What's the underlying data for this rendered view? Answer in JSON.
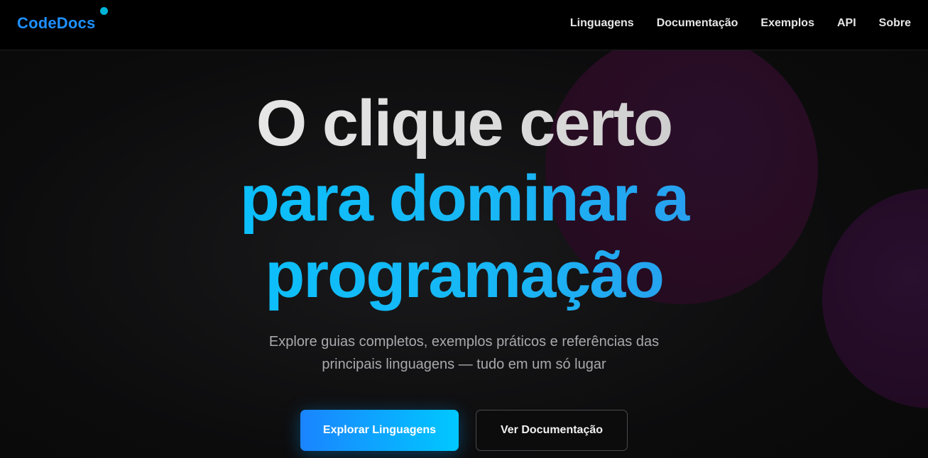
{
  "header": {
    "logo": "CodeDocs",
    "nav": [
      {
        "label": "Linguagens"
      },
      {
        "label": "Documentação"
      },
      {
        "label": "Exemplos"
      },
      {
        "label": "API"
      },
      {
        "label": "Sobre"
      }
    ]
  },
  "hero": {
    "title_line1": "O clique certo",
    "title_line2": "para dominar a",
    "title_line3": "programação",
    "subtitle": "Explore guias completos, exemplos práticos e referências das principais linguagens — tudo em um só lugar",
    "primary_button": "Explorar Linguagens",
    "secondary_button": "Ver Documentação"
  },
  "colors": {
    "brand": "#1e90ff",
    "accent_cyan": "#00c8ff",
    "background": "#0b0b0c"
  }
}
